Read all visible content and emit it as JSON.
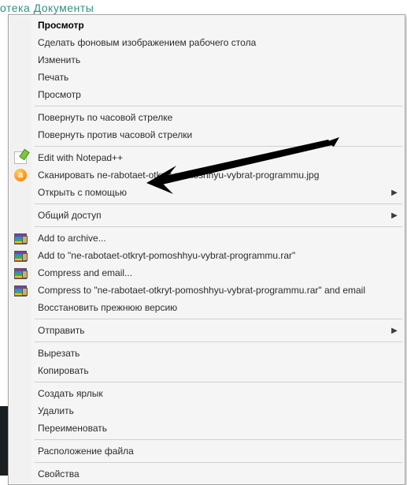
{
  "header_fragment": "отека  Документы",
  "menu": {
    "groups": [
      [
        {
          "id": "preview-bold",
          "label": "Просмотр",
          "bold": true
        },
        {
          "id": "set-wallpaper",
          "label": "Сделать фоновым изображением рабочего стола"
        },
        {
          "id": "edit",
          "label": "Изменить"
        },
        {
          "id": "print",
          "label": "Печать"
        },
        {
          "id": "preview",
          "label": "Просмотр"
        }
      ],
      [
        {
          "id": "rotate-cw",
          "label": "Повернуть по часовой стрелке"
        },
        {
          "id": "rotate-ccw",
          "label": "Повернуть против часовой стрелки"
        }
      ],
      [
        {
          "id": "edit-npp",
          "label": "Edit with Notepad++",
          "icon": "notepadpp"
        },
        {
          "id": "avast-scan",
          "label": "Сканировать ne-rabotaet-otkryt-pomoshhyu-vybrat-programmu.jpg",
          "icon": "avast"
        },
        {
          "id": "open-with",
          "label": "Открыть с помощью",
          "submenu": true
        }
      ],
      [
        {
          "id": "share",
          "label": "Общий доступ",
          "submenu": true
        }
      ],
      [
        {
          "id": "rar-add",
          "label": "Add to archive...",
          "icon": "rar"
        },
        {
          "id": "rar-add-named",
          "label": "Add to \"ne-rabotaet-otkryt-pomoshhyu-vybrat-programmu.rar\"",
          "icon": "rar"
        },
        {
          "id": "rar-email",
          "label": "Compress and email...",
          "icon": "rar"
        },
        {
          "id": "rar-email-named",
          "label": "Compress to \"ne-rabotaet-otkryt-pomoshhyu-vybrat-programmu.rar\" and email",
          "icon": "rar"
        },
        {
          "id": "restore-prev",
          "label": "Восстановить прежнюю версию"
        }
      ],
      [
        {
          "id": "send-to",
          "label": "Отправить",
          "submenu": true
        }
      ],
      [
        {
          "id": "cut",
          "label": "Вырезать"
        },
        {
          "id": "copy",
          "label": "Копировать"
        }
      ],
      [
        {
          "id": "create-shortcut",
          "label": "Создать ярлык"
        },
        {
          "id": "delete",
          "label": "Удалить"
        },
        {
          "id": "rename",
          "label": "Переименовать"
        }
      ],
      [
        {
          "id": "file-location",
          "label": "Расположение файла"
        }
      ],
      [
        {
          "id": "properties",
          "label": "Свойства"
        }
      ]
    ]
  },
  "annotation": {
    "target_id": "open-with"
  }
}
